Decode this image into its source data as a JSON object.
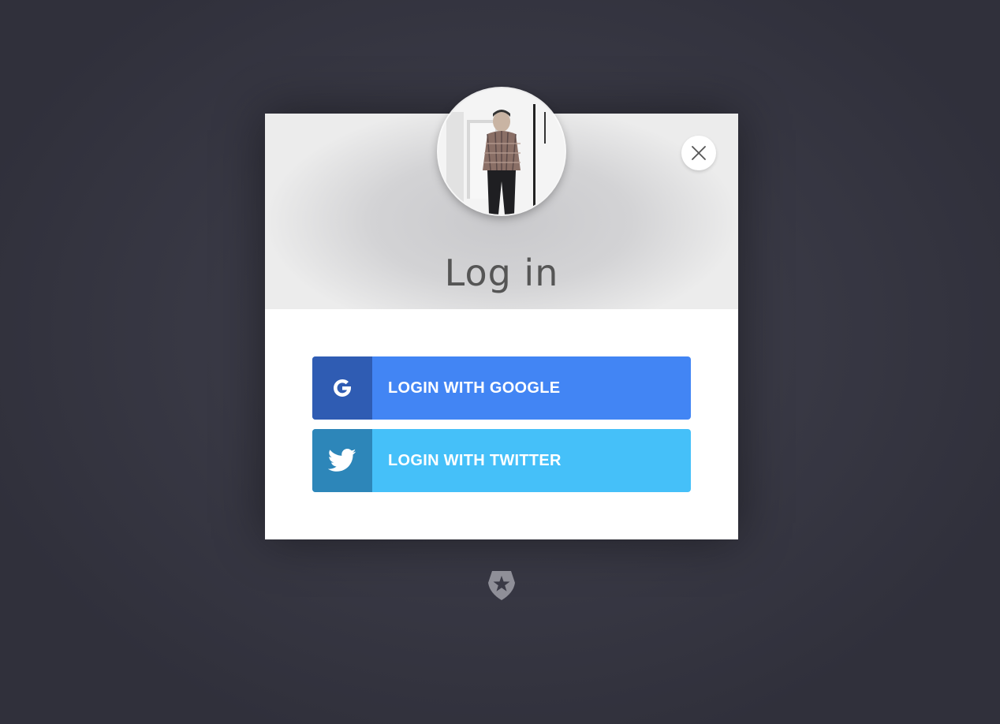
{
  "modal": {
    "title": "Log in",
    "close_icon": "close-icon",
    "avatar": "user-avatar-photo"
  },
  "buttons": {
    "google": {
      "label": "LOGIN WITH GOOGLE",
      "icon": "google-icon",
      "icon_bg": "#2f5cb3",
      "bg": "#4285f4"
    },
    "twitter": {
      "label": "LOGIN WITH TWITTER",
      "icon": "twitter-icon",
      "icon_bg": "#2d86b9",
      "bg": "#45c0f9"
    }
  },
  "footer": {
    "logo": "auth0-shield-logo"
  }
}
